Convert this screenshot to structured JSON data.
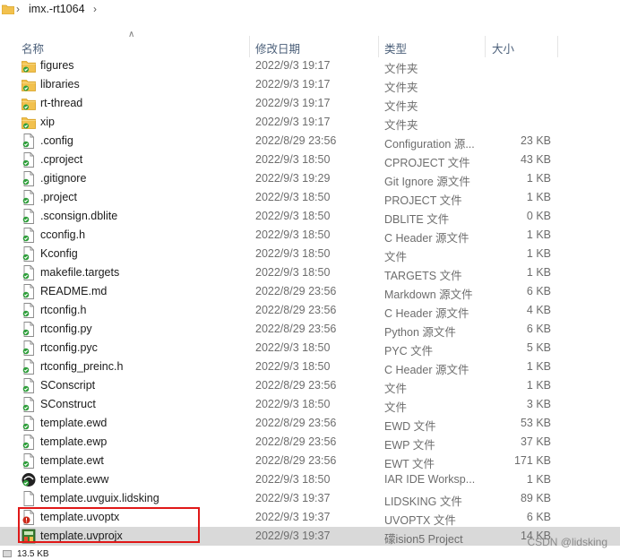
{
  "breadcrumb": {
    "path": "imx.-rt1064",
    "separator": "›"
  },
  "columns": {
    "name": "名称",
    "modified": "修改日期",
    "type": "类型",
    "size": "大小"
  },
  "files": [
    {
      "name": "figures",
      "date": "2022/9/3 19:17",
      "type": "文件夹",
      "size": "",
      "icon": "folder-icon"
    },
    {
      "name": "libraries",
      "date": "2022/9/3 19:17",
      "type": "文件夹",
      "size": "",
      "icon": "folder-icon"
    },
    {
      "name": "rt-thread",
      "date": "2022/9/3 19:17",
      "type": "文件夹",
      "size": "",
      "icon": "folder-icon"
    },
    {
      "name": "xip",
      "date": "2022/9/3 19:17",
      "type": "文件夹",
      "size": "",
      "icon": "folder-icon"
    },
    {
      "name": ".config",
      "date": "2022/8/29 23:56",
      "type": "Configuration 源...",
      "size": "23 KB",
      "icon": "file-synced-icon"
    },
    {
      "name": ".cproject",
      "date": "2022/9/3 18:50",
      "type": "CPROJECT 文件",
      "size": "43 KB",
      "icon": "file-synced-icon"
    },
    {
      "name": ".gitignore",
      "date": "2022/9/3 19:29",
      "type": "Git Ignore 源文件",
      "size": "1 KB",
      "icon": "file-synced-icon"
    },
    {
      "name": ".project",
      "date": "2022/9/3 18:50",
      "type": "PROJECT 文件",
      "size": "1 KB",
      "icon": "file-synced-icon"
    },
    {
      "name": ".sconsign.dblite",
      "date": "2022/9/3 18:50",
      "type": "DBLITE 文件",
      "size": "0 KB",
      "icon": "file-synced-icon"
    },
    {
      "name": "cconfig.h",
      "date": "2022/9/3 18:50",
      "type": "C Header 源文件",
      "size": "1 KB",
      "icon": "file-synced-icon"
    },
    {
      "name": "Kconfig",
      "date": "2022/9/3 18:50",
      "type": "文件",
      "size": "1 KB",
      "icon": "file-synced-icon"
    },
    {
      "name": "makefile.targets",
      "date": "2022/9/3 18:50",
      "type": "TARGETS 文件",
      "size": "1 KB",
      "icon": "file-synced-icon"
    },
    {
      "name": "README.md",
      "date": "2022/8/29 23:56",
      "type": "Markdown 源文件",
      "size": "6 KB",
      "icon": "file-synced-icon"
    },
    {
      "name": "rtconfig.h",
      "date": "2022/8/29 23:56",
      "type": "C Header 源文件",
      "size": "4 KB",
      "icon": "file-synced-icon"
    },
    {
      "name": "rtconfig.py",
      "date": "2022/8/29 23:56",
      "type": "Python 源文件",
      "size": "6 KB",
      "icon": "file-synced-icon"
    },
    {
      "name": "rtconfig.pyc",
      "date": "2022/9/3 18:50",
      "type": "PYC 文件",
      "size": "5 KB",
      "icon": "file-synced-icon"
    },
    {
      "name": "rtconfig_preinc.h",
      "date": "2022/9/3 18:50",
      "type": "C Header 源文件",
      "size": "1 KB",
      "icon": "file-synced-icon"
    },
    {
      "name": "SConscript",
      "date": "2022/8/29 23:56",
      "type": "文件",
      "size": "1 KB",
      "icon": "file-synced-icon"
    },
    {
      "name": "SConstruct",
      "date": "2022/9/3 18:50",
      "type": "文件",
      "size": "3 KB",
      "icon": "file-synced-icon"
    },
    {
      "name": "template.ewd",
      "date": "2022/8/29 23:56",
      "type": "EWD 文件",
      "size": "53 KB",
      "icon": "file-synced-icon"
    },
    {
      "name": "template.ewp",
      "date": "2022/8/29 23:56",
      "type": "EWP 文件",
      "size": "37 KB",
      "icon": "file-synced-icon"
    },
    {
      "name": "template.ewt",
      "date": "2022/8/29 23:56",
      "type": "EWT 文件",
      "size": "171 KB",
      "icon": "file-synced-icon"
    },
    {
      "name": "template.eww",
      "date": "2022/9/3 18:50",
      "type": "IAR IDE Worksp...",
      "size": "1 KB",
      "icon": "iar-workspace-icon"
    },
    {
      "name": "template.uvguix.lidsking",
      "date": "2022/9/3 19:37",
      "type": "LIDSKING 文件",
      "size": "89 KB",
      "icon": "blank-file-icon"
    },
    {
      "name": "template.uvoptx",
      "date": "2022/9/3 19:37",
      "type": "UVOPTX 文件",
      "size": "6 KB",
      "icon": "file-error-icon"
    },
    {
      "name": "template.uvprojx",
      "date": "2022/9/3 19:37",
      "type": "礞ision5 Project",
      "size": "14 KB",
      "icon": "keil-project-icon",
      "selected": true
    }
  ],
  "status": {
    "text": "13.5 KB"
  },
  "watermark": "CSDN @lidsking",
  "colors": {
    "folder": "#f2c14e",
    "synced": "#2f9e3b",
    "error": "#cc2a1b",
    "highlight": "#e01818"
  }
}
